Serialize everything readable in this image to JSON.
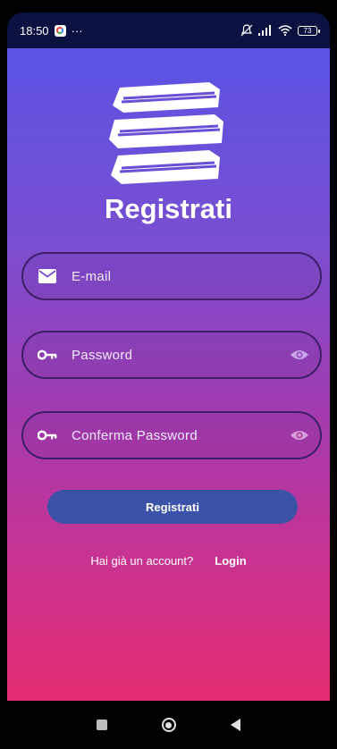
{
  "status_bar": {
    "time": "18:50",
    "more": "···",
    "battery": "73"
  },
  "icons": {
    "logo": "stacked-books-icon",
    "email": "envelope-icon",
    "password": "key-icon",
    "visibility": "eye-icon"
  },
  "form": {
    "title": "Registrati",
    "email_label": "E-mail",
    "password_label": "Password",
    "confirm_password_label": "Conferma Password",
    "submit_label": "Registrati"
  },
  "footer": {
    "prompt": "Hai già un account?",
    "login_link": "Login"
  },
  "colors": {
    "gradient_top": "#5a53e3",
    "gradient_bottom": "#e42c70",
    "button": "#3a52a8",
    "field_border": "#3c1f66"
  }
}
